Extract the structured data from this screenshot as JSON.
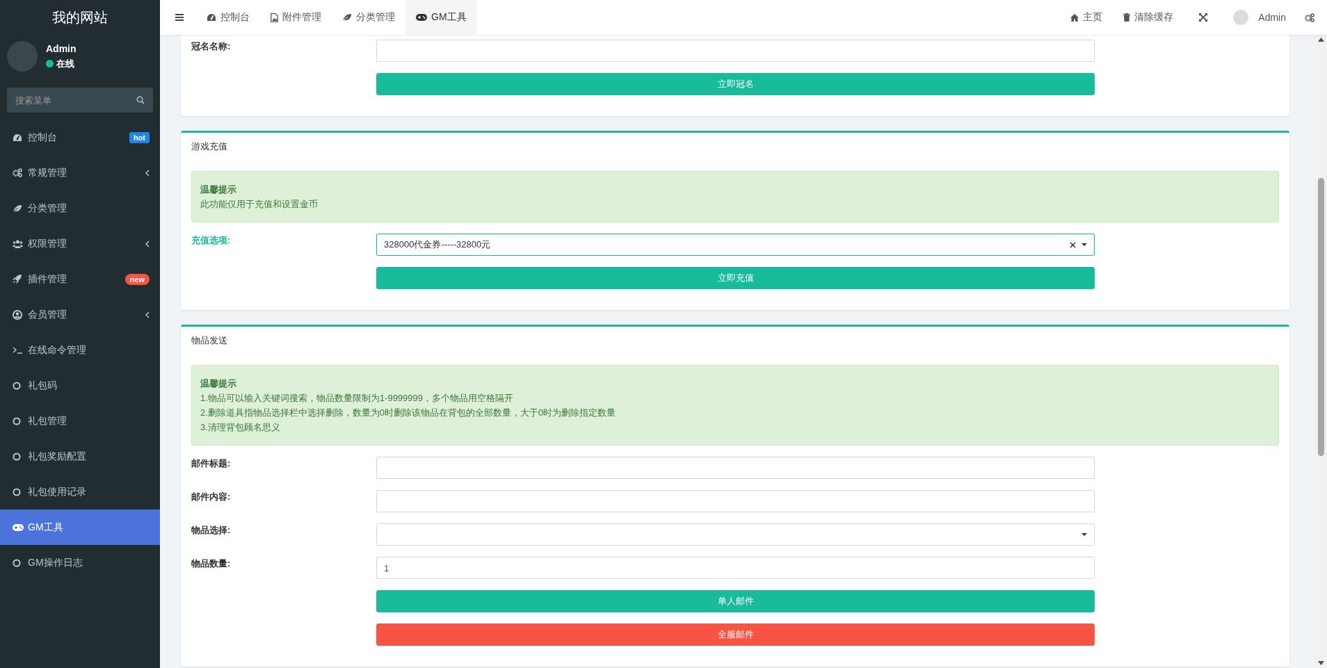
{
  "sidebar": {
    "logo": "我的网站",
    "user": {
      "name": "Admin",
      "status": "在线"
    },
    "search": {
      "placeholder": "搜索菜单"
    },
    "items": [
      {
        "label": "控制台",
        "badge": {
          "text": "hot",
          "color": "#1e88e5"
        },
        "submenu": false,
        "selected": false
      },
      {
        "label": "常规管理",
        "submenu": true,
        "selected": false
      },
      {
        "label": "分类管理",
        "submenu": false,
        "selected": false
      },
      {
        "label": "权限管理",
        "submenu": true,
        "selected": false
      },
      {
        "label": "插件管理",
        "badge": {
          "text": "new",
          "color": "#f75444"
        },
        "submenu": false,
        "selected": false
      },
      {
        "label": "会员管理",
        "submenu": true,
        "selected": false
      },
      {
        "label": "在线命令管理",
        "submenu": false,
        "selected": false
      },
      {
        "label": "礼包码",
        "submenu": false,
        "selected": false
      },
      {
        "label": "礼包管理",
        "submenu": false,
        "selected": false
      },
      {
        "label": "礼包奖励配置",
        "submenu": false,
        "selected": false
      },
      {
        "label": "礼包使用记录",
        "submenu": false,
        "selected": false
      },
      {
        "label": "GM工具",
        "submenu": false,
        "selected": true
      },
      {
        "label": "GM操作日志",
        "submenu": false,
        "selected": false
      }
    ]
  },
  "topbar": {
    "tabs": [
      {
        "label": "控制台",
        "selected": false
      },
      {
        "label": "附件管理",
        "selected": false
      },
      {
        "label": "分类管理",
        "selected": false
      },
      {
        "label": "GM工具",
        "selected": true
      }
    ],
    "home": "主页",
    "clear_cache": "清除缓存",
    "user": "Admin"
  },
  "sections": [
    {
      "fields": [
        {
          "label": "冠名名称:",
          "kind": "text",
          "focused": false
        }
      ],
      "buttons": [
        {
          "label": "立即冠名",
          "color": "#18bc9c"
        }
      ]
    },
    {
      "title": "游戏充值",
      "alert": {
        "title": "温馨提示",
        "lines": [
          "此功能仅用于充值和设置金币"
        ]
      },
      "fields": [
        {
          "label": "充值选项:",
          "kind": "select",
          "value": "328000代金券-----32800元",
          "focused": true
        }
      ],
      "buttons": [
        {
          "label": "立即充值",
          "color": "#18bc9c"
        }
      ]
    },
    {
      "title": "物品发送",
      "alert": {
        "title": "温馨提示",
        "lines": [
          "1.物品可以输入关键词搜索，物品数量限制为1-9999999，多个物品用空格隔开",
          "2.删除道具指物品选择栏中选择删除，数量为0时删除该物品在背包的全部数量，大于0时为删除指定数量",
          "3.清理背包顾名思义"
        ]
      },
      "fields": [
        {
          "label": "邮件标题:",
          "kind": "text",
          "focused": false
        },
        {
          "label": "邮件内容:",
          "kind": "text",
          "focused": false
        },
        {
          "label": "物品选择:",
          "kind": "select",
          "focused": false
        },
        {
          "label": "物品数量:",
          "kind": "text",
          "value": "1",
          "focused": false
        }
      ],
      "buttons": [
        {
          "label": "单人邮件",
          "color": "#18bc9c"
        },
        {
          "label": "全服邮件",
          "color": "#f75444"
        }
      ]
    }
  ]
}
